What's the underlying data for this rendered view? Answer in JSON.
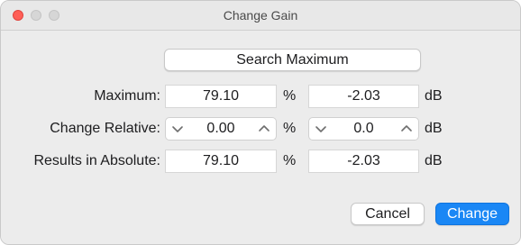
{
  "window": {
    "title": "Change Gain"
  },
  "search_button": {
    "label": "Search Maximum"
  },
  "rows": {
    "maximum": {
      "label": "Maximum:",
      "percent_value": "79.10",
      "percent_unit": "%",
      "db_value": "-2.03",
      "db_unit": "dB"
    },
    "change_relative": {
      "label": "Change Relative:",
      "percent_value": "0.00",
      "percent_unit": "%",
      "db_value": "0.0",
      "db_unit": "dB"
    },
    "results_absolute": {
      "label": "Results in Absolute:",
      "percent_value": "79.10",
      "percent_unit": "%",
      "db_value": "-2.03",
      "db_unit": "dB"
    }
  },
  "footer": {
    "cancel_label": "Cancel",
    "change_label": "Change"
  },
  "icons": {
    "decrement": "chevron-down-icon",
    "increment": "chevron-up-icon",
    "close": "close-icon",
    "minimize": "minimize-icon",
    "zoom": "zoom-icon"
  },
  "colors": {
    "accent": "#1a87f5",
    "close_button": "#ff5f57"
  }
}
